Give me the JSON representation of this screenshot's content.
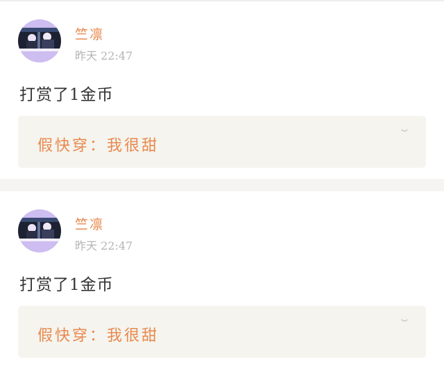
{
  "comments": [
    {
      "username": "竺凛",
      "time": "昨天 22:47",
      "message": "打赏了1金币",
      "reply": "假快穿：我很甜",
      "avatar_icon": "user-avatar-icon",
      "expand_icon": "chevron-down-icon"
    },
    {
      "username": "竺凛",
      "time": "昨天 22:47",
      "message": "打赏了1金币",
      "reply": "假快穿：我很甜",
      "avatar_icon": "user-avatar-icon",
      "expand_icon": "chevron-down-icon"
    }
  ],
  "colors": {
    "accent": "#e8894f",
    "time": "#b4b4b4",
    "text": "#333333",
    "reply_bg": "#f5f4ee",
    "separator": "#f5f4f2"
  }
}
